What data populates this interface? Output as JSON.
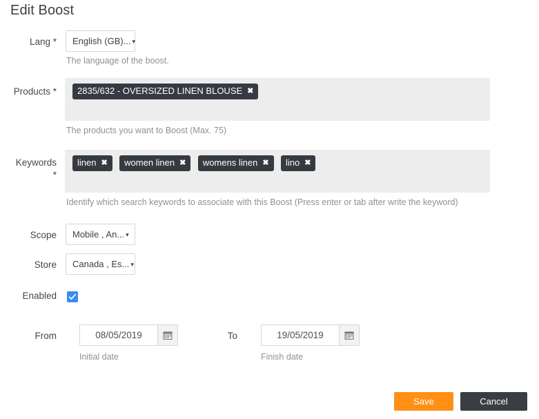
{
  "page": {
    "title": "Edit Boost"
  },
  "fields": {
    "lang": {
      "label": "Lang *",
      "value": "English (GB)...",
      "helper": "The language of the boost.",
      "caret": "▾"
    },
    "products": {
      "label": "Products *",
      "helper": "The products you want to Boost (Max. 75)",
      "tags": [
        "2835/632 - OVERSIZED LINEN BLOUSE"
      ],
      "remove_glyph": "✖"
    },
    "keywords": {
      "label_line1": "Keywords",
      "label_line2": "*",
      "helper": "Identify which search keywords to associate with this Boost (Press enter or tab after write the keyword)",
      "tags": [
        "linen",
        "women linen",
        "womens linen",
        "lino"
      ],
      "remove_glyph": "✖"
    },
    "scope": {
      "label": "Scope",
      "value": "Mobile , An...",
      "caret": "▾"
    },
    "store": {
      "label": "Store",
      "value": "Canada , Es...",
      "caret": "▾"
    },
    "enabled": {
      "label": "Enabled",
      "checked": true
    },
    "from": {
      "label": "From",
      "value": "08/05/2019",
      "helper": "Initial date",
      "icon": "calendar-icon"
    },
    "to": {
      "label": "To",
      "value": "19/05/2019",
      "helper": "Finish date",
      "icon": "calendar-icon"
    }
  },
  "actions": {
    "save_label": "Save",
    "cancel_label": "Cancel"
  },
  "colors": {
    "accent_save": "#ff9015",
    "cancel": "#3a3d42",
    "tag": "#363a41",
    "checkbox": "#3b8bf5",
    "tag_area": "#ededed"
  }
}
